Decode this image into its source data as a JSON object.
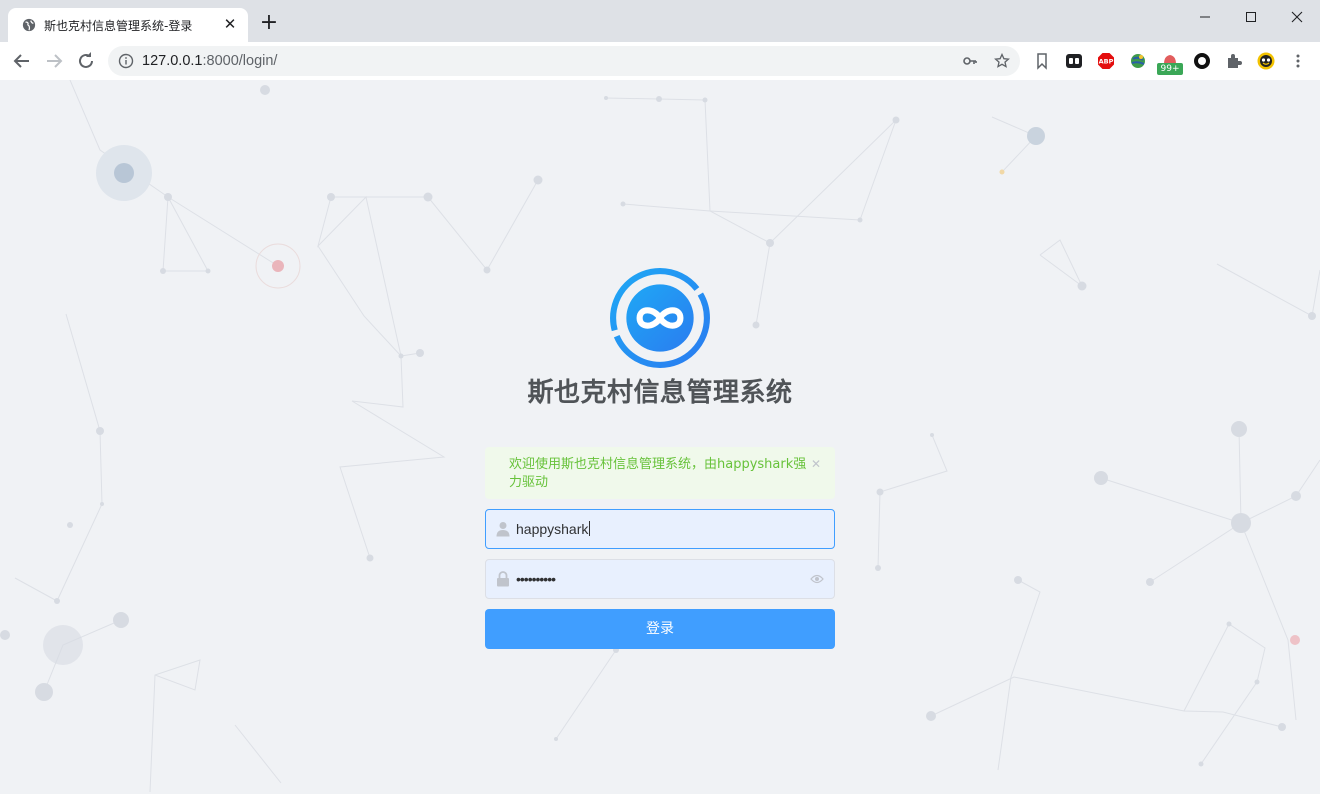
{
  "browser": {
    "tab_title": "斯也克村信息管理系统-登录",
    "url_host": "127.0.0.1",
    "url_rest": ":8000/login/",
    "extensions": [
      "todo-icon",
      "adblock-plus-icon",
      "globe-extension-icon",
      "notification-extension-icon",
      "circle-extension-icon",
      "puzzle-icon",
      "profile-avatar-icon"
    ],
    "badge_count": "99+"
  },
  "login": {
    "system_title": "斯也克村信息管理系统",
    "alert_message": "欢迎使用斯也克村信息管理系统，由happyshark强力驱动",
    "username_value": "happyshark",
    "password_value": "••••••••••",
    "login_label": "登录"
  },
  "colors": {
    "accent": "#409eff",
    "success": "#67c23a",
    "success_bg": "#f0f9eb",
    "autofill_bg": "#e8f0fe"
  }
}
